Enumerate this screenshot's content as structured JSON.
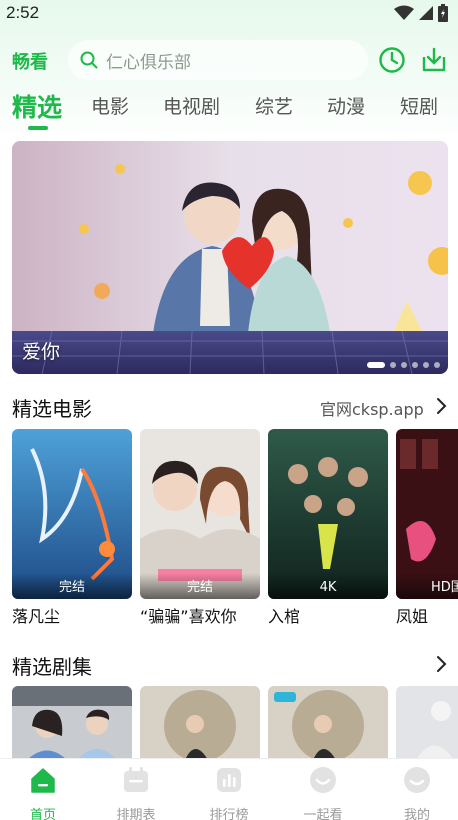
{
  "status": {
    "time": "2:52"
  },
  "header": {
    "logo": "畅看",
    "search_placeholder": "仁心俱乐部"
  },
  "tabs": [
    "精选",
    "电影",
    "电视剧",
    "综艺",
    "动漫",
    "短剧"
  ],
  "banner": {
    "title": "爱你",
    "slide_count": 6,
    "active_slide": 0
  },
  "featured_movies": {
    "title": "精选电影",
    "link": "官网cksp.app",
    "items": [
      {
        "title": "落凡尘",
        "badge": "完结"
      },
      {
        "title": "“骗骗”喜欢你",
        "badge": "完结"
      },
      {
        "title": "入棺",
        "badge": "4K"
      },
      {
        "title": "凤姐",
        "badge": "HD国"
      }
    ]
  },
  "featured_series": {
    "title": "精选剧集"
  },
  "bottom_nav": [
    {
      "label": "首页",
      "icon": "home-icon",
      "active": true
    },
    {
      "label": "排期表",
      "icon": "calendar-icon",
      "active": false
    },
    {
      "label": "排行榜",
      "icon": "ranking-icon",
      "active": false
    },
    {
      "label": "一起看",
      "icon": "watch-together-icon",
      "active": false
    },
    {
      "label": "我的",
      "icon": "profile-icon",
      "active": false
    }
  ],
  "colors": {
    "accent": "#1fb84a",
    "text": "#111111",
    "muted": "#9a9a9a"
  }
}
